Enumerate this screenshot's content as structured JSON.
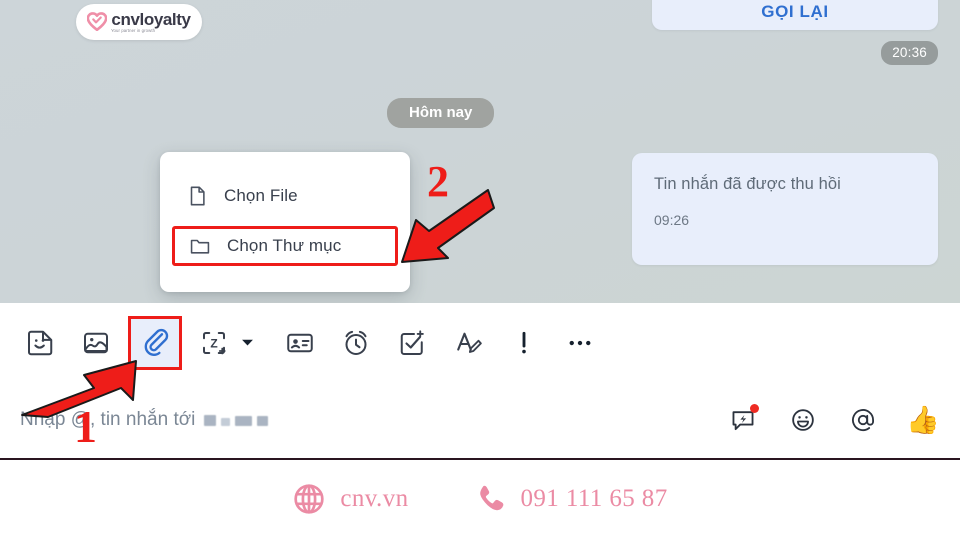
{
  "brand": {
    "logo_word": "cnvloyalty",
    "logo_tagline": "Your partner in growth",
    "heart_color": "#ef8fa8"
  },
  "chat": {
    "callback_button_label": "GỌI LẠI",
    "callback_time": "20:36",
    "day_divider": "Hôm nay",
    "recalled_message": "Tin nhắn đã được thu hồi",
    "recalled_time": "09:26",
    "bubble_color": "#e8eefb",
    "background_color": "#ccd4d8"
  },
  "attach_menu": {
    "items": [
      {
        "label": "Chọn File",
        "icon": "file-icon",
        "highlighted": false
      },
      {
        "label": "Chọn Thư mục",
        "icon": "folder-icon",
        "highlighted": true
      }
    ],
    "highlight_color": "#ee1d19"
  },
  "toolbar": {
    "items": [
      {
        "name": "sticker-icon",
        "label": "Sticker"
      },
      {
        "name": "image-icon",
        "label": "Hình ảnh"
      },
      {
        "name": "attachment-icon",
        "label": "Đính kèm File"
      },
      {
        "name": "screen-capture-icon",
        "label": "Chụp màn hình"
      },
      {
        "name": "business-card-icon",
        "label": "Danh thiếp"
      },
      {
        "name": "alarm-clock-icon",
        "label": "Nhắc hẹn"
      },
      {
        "name": "task-icon",
        "label": "Tạo nhắc việc"
      },
      {
        "name": "text-format-icon",
        "label": "Định dạng"
      },
      {
        "name": "priority-icon",
        "label": "Tin quan trọng"
      },
      {
        "name": "more-options-icon",
        "label": "Tùy chọn khác"
      }
    ],
    "active_item": "attachment-icon",
    "active_accent": "#2f6fd0"
  },
  "composer": {
    "placeholder_prefix": "Nhập @, tin nhắn tới",
    "actions": [
      {
        "name": "quick-message-icon",
        "label": "Tin nhắn nhanh",
        "badge": true
      },
      {
        "name": "emoji-icon",
        "label": "Biểu cảm",
        "badge": false
      },
      {
        "name": "mention-icon",
        "label": "Nhắc tên",
        "badge": false
      },
      {
        "name": "thumbs-up-icon",
        "label": "👍",
        "badge": false
      }
    ]
  },
  "footer": {
    "website": "cnv.vn",
    "phone": "091 111 65 87",
    "accent_color": "#eb8ba4"
  },
  "annotations": [
    {
      "label": "1",
      "target": "attachment-icon",
      "direction": "up-right"
    },
    {
      "label": "2",
      "target": "folder-menu-item",
      "direction": "down-left"
    }
  ]
}
